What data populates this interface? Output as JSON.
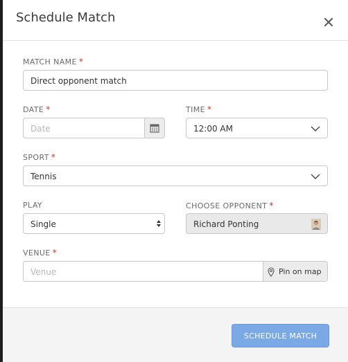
{
  "dialog": {
    "title": "Schedule Match",
    "close_icon": "close-icon"
  },
  "form": {
    "match_name": {
      "label": "MATCH NAME",
      "required": "*",
      "value": "Direct opponent match"
    },
    "date": {
      "label": "DATE",
      "required": "*",
      "placeholder": "Date",
      "icon": "calendar-icon"
    },
    "time": {
      "label": "TIME",
      "required": "*",
      "value": "12:00 AM",
      "icon": "chevron-down-icon"
    },
    "sport": {
      "label": "SPORT",
      "required": "*",
      "value": "Tennis",
      "icon": "chevron-down-icon"
    },
    "play": {
      "label": "PLAY",
      "value": "Single",
      "icon": "updown-arrows-icon"
    },
    "opponent": {
      "label": "CHOOSE OPPONENT",
      "required": "*",
      "value": "Richard Ponting",
      "avatar": "avatar"
    },
    "venue": {
      "label": "VENUE",
      "required": "*",
      "placeholder": "Venue",
      "pin_label": "Pin on map",
      "icon": "map-pin-icon"
    }
  },
  "footer": {
    "submit_label": "SCHEDULE MATCH"
  },
  "colors": {
    "accent_button": "#7ba9e6",
    "required_mark": "#c0392b",
    "disabled_field": "#e9e9e9"
  }
}
